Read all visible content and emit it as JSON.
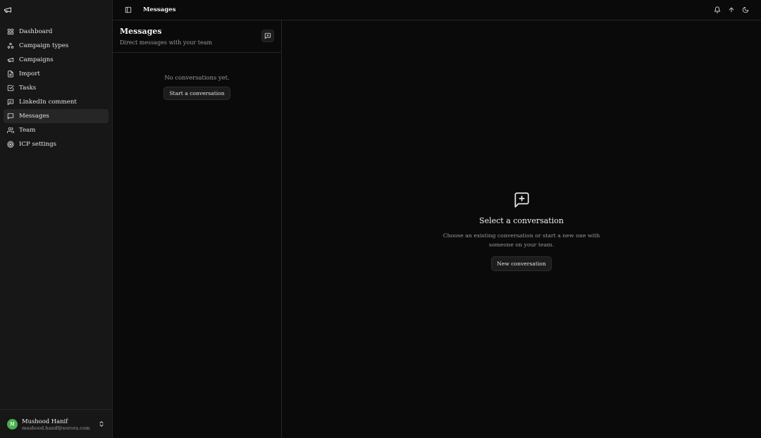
{
  "sidebar": {
    "items": [
      {
        "label": "Dashboard",
        "icon": "grid-icon"
      },
      {
        "label": "Campaign types",
        "icon": "shapes-icon"
      },
      {
        "label": "Campaigns",
        "icon": "megaphone-icon"
      },
      {
        "label": "Import",
        "icon": "file-icon"
      },
      {
        "label": "Tasks",
        "icon": "checkbox-icon"
      },
      {
        "label": "LinkedIn comment",
        "icon": "message-square-icon"
      },
      {
        "label": "Messages",
        "icon": "chat-icon",
        "active": true
      },
      {
        "label": "Team",
        "icon": "users-icon"
      },
      {
        "label": "ICP settings",
        "icon": "target-icon"
      }
    ],
    "user": {
      "initial": "M",
      "name": "Mushood Hanif",
      "email": "mushood.hanif@xorora.com"
    }
  },
  "topbar": {
    "title": "Messages"
  },
  "list": {
    "title": "Messages",
    "subtitle": "Direct messages with your team",
    "empty_text": "No conversations yet.",
    "start_button": "Start a conversation"
  },
  "detail": {
    "title": "Select a conversation",
    "description": "Choose an existing conversation or start a new one with someone on your team.",
    "new_button": "New conversation"
  },
  "colors": {
    "background": "#0a0a0a",
    "sidebar": "#171717",
    "avatar": "#4caf50"
  }
}
